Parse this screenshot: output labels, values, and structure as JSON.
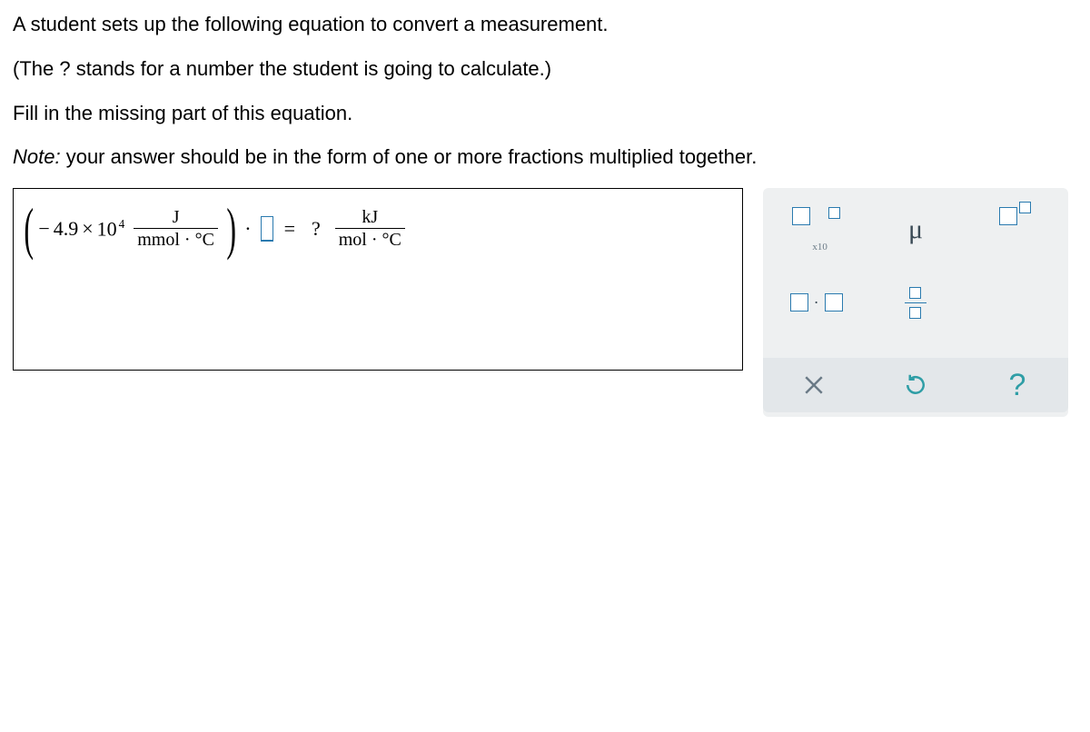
{
  "prompt": {
    "line1": "A student sets up the following equation to convert a measurement.",
    "line2": "(The ? stands for a number the student is going to calculate.)",
    "line3": "Fill in the missing part of this equation.",
    "note_prefix": "Note:",
    "note_rest": " your answer should be in the form of one or more fractions multiplied together."
  },
  "equation": {
    "coef_sign": "−",
    "coef_val": "4.9",
    "coef_times": "×",
    "coef_base": "10",
    "coef_exp": "4",
    "frac1_num": "J",
    "frac1_den": "mmol · °C",
    "dot": "·",
    "equals": "=",
    "qmark": "?",
    "frac2_num": "kJ",
    "frac2_den": "mol · °C"
  },
  "palette": {
    "sci_label": "x10",
    "mu": "μ",
    "mult_dot": "·",
    "help": "?"
  }
}
